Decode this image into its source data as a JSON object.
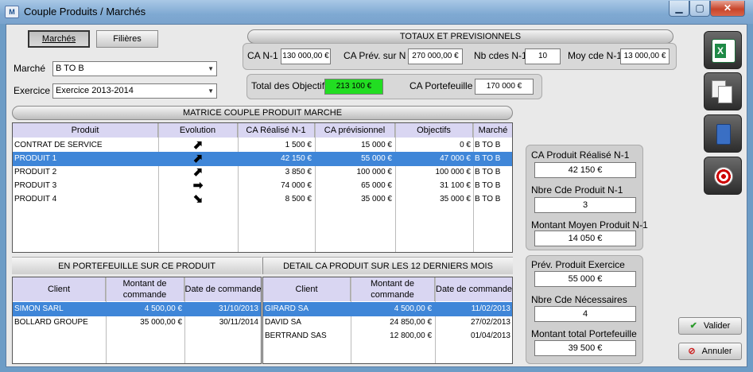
{
  "window": {
    "title": "Couple Produits / Marchés",
    "icon_text": "M"
  },
  "tabs": {
    "marches": "Marchés",
    "filieres": "Filières"
  },
  "filters": {
    "marche_label": "Marché",
    "marche_value": "B TO B",
    "exercice_label": "Exercice",
    "exercice_value": "Exercice 2013-2014"
  },
  "totaux": {
    "title": "TOTAUX ET PREVISIONNELS",
    "ca_n1_label": "CA N-1",
    "ca_n1": "130 000,00 €",
    "ca_prev_label": "CA Prév. sur N",
    "ca_prev": "270 000,00 €",
    "nb_cdes_label": "Nb cdes N-1",
    "nb_cdes": "10",
    "moy_cde_label": "Moy cde N-1",
    "moy_cde": "13 000,00 €",
    "total_obj_label": "Total des Objectifs",
    "total_obj": "213 100 €",
    "ca_port_label": "CA Portefeuille",
    "ca_port": "170 000 €"
  },
  "matrice": {
    "title": "MATRICE COUPLE PRODUIT MARCHE",
    "headers": [
      "Produit",
      "Evolution",
      "CA Réalisé N-1",
      "CA prévisionnel",
      "Objectifs",
      "Marché"
    ],
    "rows": [
      {
        "produit": "CONTRAT DE SERVICE",
        "evolution": "up-right",
        "ca": "1 500 €",
        "prev": "15 000 €",
        "obj": "0 €",
        "marche": "B TO B"
      },
      {
        "produit": "PRODUIT 1",
        "evolution": "up-right",
        "ca": "42 150 €",
        "prev": "55 000 €",
        "obj": "47 000 €",
        "marche": "B TO B"
      },
      {
        "produit": "PRODUIT 2",
        "evolution": "up-right",
        "ca": "3 850 €",
        "prev": "100 000 €",
        "obj": "100 000 €",
        "marche": "B TO B"
      },
      {
        "produit": "PRODUIT 3",
        "evolution": "right",
        "ca": "74 000 €",
        "prev": "65 000 €",
        "obj": "31 100 €",
        "marche": "B TO B"
      },
      {
        "produit": "PRODUIT 4",
        "evolution": "down-right",
        "ca": "8 500 €",
        "prev": "35 000 €",
        "obj": "35 000 €",
        "marche": "B TO B"
      }
    ]
  },
  "portefeuille": {
    "title": "EN PORTEFEUILLE SUR CE PRODUIT",
    "headers": [
      "Client",
      "Montant de commande",
      "Date de commande"
    ],
    "rows": [
      {
        "client": "SIMON SARL",
        "montant": "4 500,00 €",
        "date": "31/10/2013"
      },
      {
        "client": "BOLLARD GROUPE",
        "montant": "35 000,00 €",
        "date": "30/11/2014"
      }
    ]
  },
  "detail": {
    "title": "DETAIL CA PRODUIT SUR LES 12 DERNIERS MOIS",
    "headers": [
      "Client",
      "Montant de commande",
      "Date de commande"
    ],
    "rows": [
      {
        "client": "GIRARD SA",
        "montant": "4 500,00 €",
        "date": "11/02/2013"
      },
      {
        "client": "DAVID SA",
        "montant": "24 850,00 €",
        "date": "27/02/2013"
      },
      {
        "client": "BERTRAND SAS",
        "montant": "12 800,00 €",
        "date": "01/04/2013"
      }
    ]
  },
  "stats1": {
    "ca_real_label": "CA Produit Réalisé N-1",
    "ca_real": "42 150 €",
    "nbre_cde_label": "Nbre Cde Produit N-1",
    "nbre_cde": "3",
    "moyen_label": "Montant Moyen Produit N-1",
    "moyen": "14 050 €"
  },
  "stats2": {
    "prev_label": "Prév. Produit Exercice",
    "prev": "55 000 €",
    "nec_label": "Nbre Cde Nécessaires",
    "nec": "4",
    "total_label": "Montant total Portefeuille",
    "total": "39 500 €"
  },
  "actions": {
    "valider": "Valider",
    "annuler": "Annuler"
  },
  "colors": {
    "accent": "#3f86d8",
    "objective": "#22dd22"
  }
}
